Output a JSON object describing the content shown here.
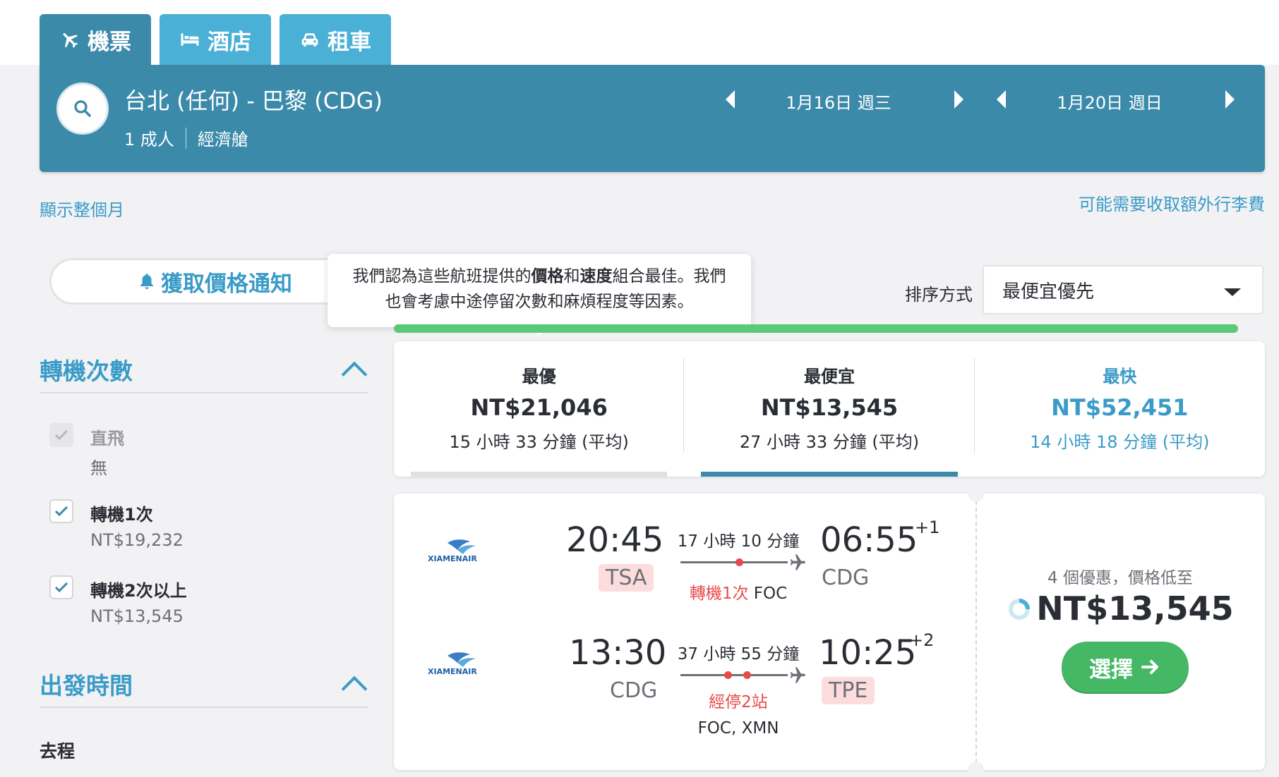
{
  "tabs": [
    {
      "label": "機票",
      "icon": "plane-icon",
      "active": true
    },
    {
      "label": "酒店",
      "icon": "bed-icon",
      "active": false
    },
    {
      "label": "租車",
      "icon": "car-icon",
      "active": false
    }
  ],
  "search": {
    "route": "台北 (任何) - 巴黎 (CDG)",
    "passengers": "1 成人",
    "cabin": "經濟艙",
    "depart_date": "1月16日 週三",
    "return_date": "1月20日 週日"
  },
  "links": {
    "show_month": "顯示整個月",
    "baggage_fee": "可能需要收取額外行李費"
  },
  "price_alert": {
    "label": "獲取價格通知"
  },
  "tooltip": {
    "line1_a": "我們認為這些航班提供的",
    "line1_b": "價格",
    "line1_c": "和",
    "line1_d": "速度",
    "line1_e": "組合最佳。我們",
    "line2": "也會考慮中途停留次數和麻煩程度等因素。"
  },
  "sort": {
    "label": "排序方式",
    "value": "最便宜優先"
  },
  "summary": [
    {
      "title": "最優",
      "price": "NT$21,046",
      "duration": "15 小時 33 分鐘 (平均)",
      "color": "#2a2d33",
      "bar": "#e0e0e3"
    },
    {
      "title": "最便宜",
      "price": "NT$13,545",
      "duration": "27 小時 33 分鐘 (平均)",
      "color": "#2a2d33",
      "bar": "#3b8aa9"
    },
    {
      "title": "最快",
      "price": "NT$52,451",
      "duration": "14 小時 18 分鐘 (平均)",
      "color": "#3a9bc8",
      "bar": ""
    }
  ],
  "filters": {
    "stops": {
      "title": "轉機次數",
      "options": [
        {
          "label": "直飛",
          "price": "無",
          "checked": true,
          "disabled": true
        },
        {
          "label": "轉機1次",
          "price": "NT$19,232",
          "checked": true,
          "disabled": false
        },
        {
          "label": "轉機2次以上",
          "price": "NT$13,545",
          "checked": true,
          "disabled": false
        }
      ]
    },
    "departure_time": {
      "title": "出發時間",
      "leg_label": "去程"
    }
  },
  "flight": {
    "airline_logo_text": "XIAMENAIR",
    "outbound": {
      "dep_time": "20:45",
      "dep_code": "TSA",
      "duration": "17 小時 10 分鐘",
      "stops_label": "轉機1次",
      "stops_via": "FOC",
      "arr_time": "06:55",
      "arr_offset": "+1",
      "arr_code": "CDG"
    },
    "inbound": {
      "dep_time": "13:30",
      "dep_code": "CDG",
      "duration": "37 小時 55 分鐘",
      "stops_label": "經停2站",
      "stops_via": "FOC, XMN",
      "arr_time": "10:25",
      "arr_offset": "+2",
      "arr_code": "TPE"
    },
    "deals_text": "4 個優惠，價格低至",
    "price": "NT$13,545",
    "select_label": "選擇"
  },
  "colors": {
    "header": "#3b8aa9",
    "tab": "#4ab0d6",
    "accent": "#3a9bc8",
    "green": "#45b866",
    "stop_red": "#e84a4a"
  }
}
